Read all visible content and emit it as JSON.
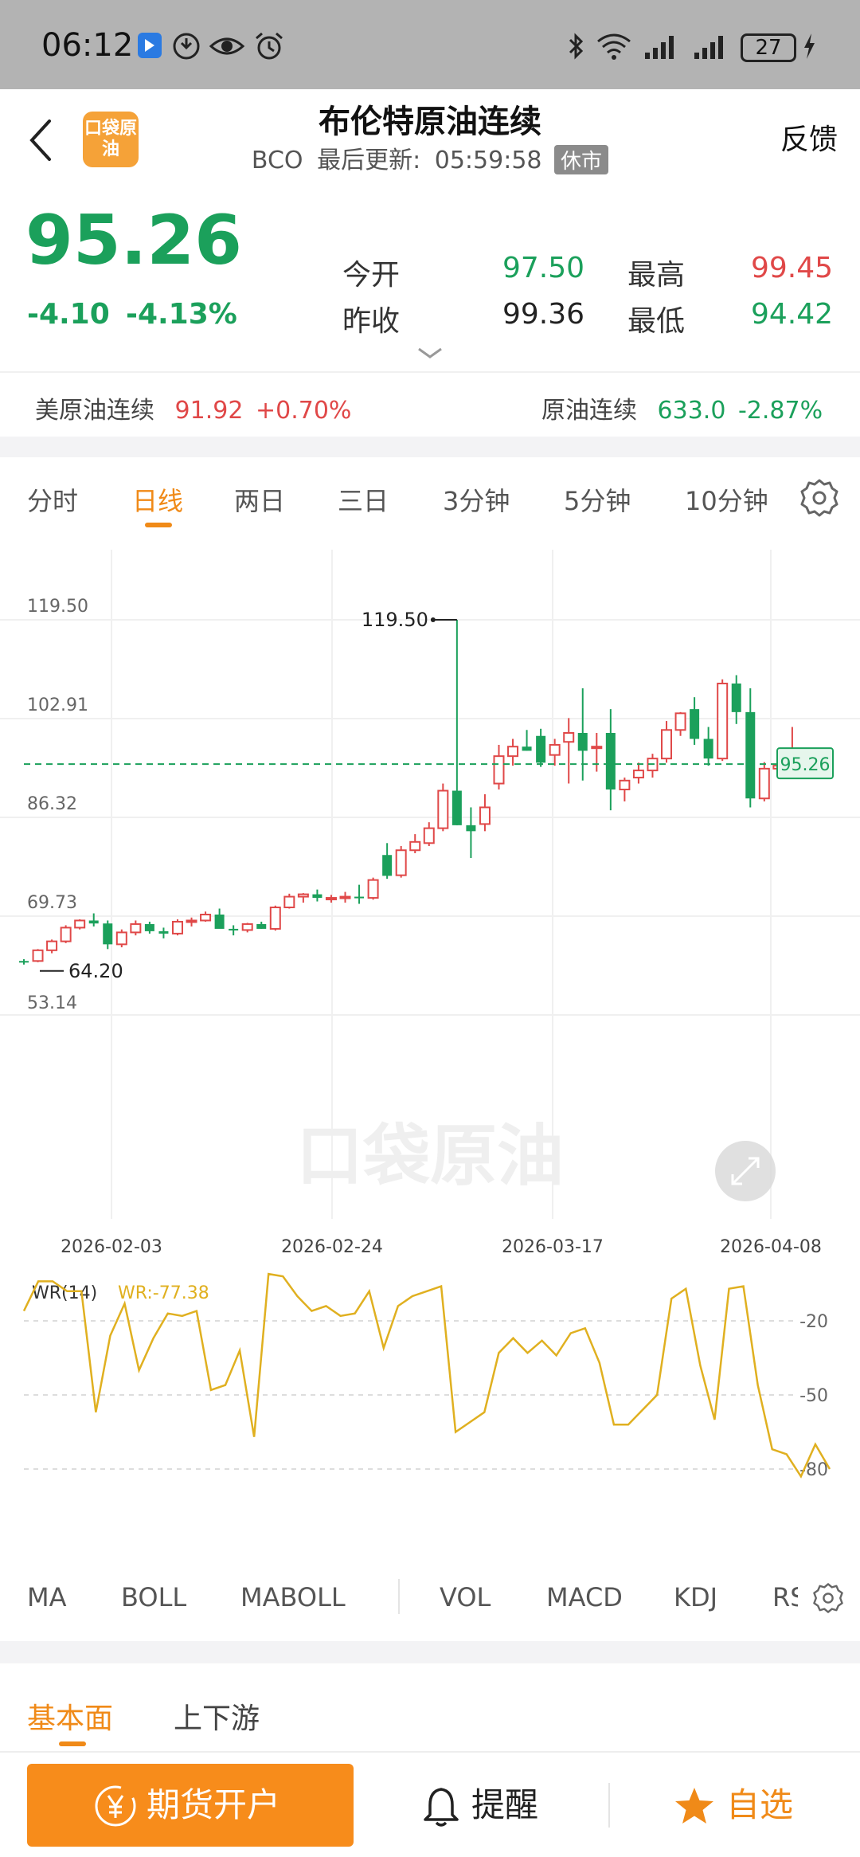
{
  "status_bar": {
    "time": "06:12",
    "battery": "27",
    "icons": [
      "app-notification-icon",
      "data-saver-icon",
      "eye-icon",
      "alarm-icon",
      "bluetooth-icon",
      "wifi-icon",
      "signal-icon",
      "signal-icon",
      "charging-icon"
    ]
  },
  "header": {
    "logo_text": "口袋原油",
    "title": "布伦特原油连续",
    "code": "BCO",
    "updated_label": "最后更新:",
    "updated_time": "05:59:58",
    "market_status": "休市",
    "feedback": "反馈"
  },
  "quote": {
    "price": "95.26",
    "change": "-4.10",
    "change_pct": "-4.13%",
    "open_label": "今开",
    "open": "97.50",
    "high_label": "最高",
    "high": "99.45",
    "prev_close_label": "昨收",
    "prev_close": "99.36",
    "low_label": "最低",
    "low": "94.42",
    "colors": {
      "down": "#1ba05b",
      "up": "#e04848"
    }
  },
  "related": [
    {
      "name": "美原油连续",
      "price": "91.92",
      "change": "+0.70%",
      "color": "#e04848"
    },
    {
      "name": "原油连续",
      "price": "633.0",
      "change": "-2.87%",
      "color": "#1ba05b"
    }
  ],
  "period_tabs": [
    "分时",
    "日线",
    "两日",
    "三日",
    "3分钟",
    "5分钟",
    "10分钟"
  ],
  "active_period": "日线",
  "chart_data": [
    {
      "type": "candlestick",
      "title": "",
      "y_ticks": [
        "119.50",
        "102.91",
        "86.32",
        "69.73",
        "53.14"
      ],
      "ylim": [
        53.14,
        119.5
      ],
      "x_ticks": [
        "2026-02-03",
        "2026-02-24",
        "2026-03-17",
        "2026-04-08"
      ],
      "annotations": {
        "max": "119.50",
        "min": "64.20",
        "current": "95.26"
      },
      "watermark": "口袋原油",
      "candles": [
        [
          62.2,
          62.5,
          61.6,
          62.0
        ],
        [
          62.2,
          64.2,
          62.0,
          64.0
        ],
        [
          64.0,
          65.8,
          63.5,
          65.5
        ],
        [
          65.5,
          68.2,
          65.2,
          67.8
        ],
        [
          67.8,
          69.2,
          67.5,
          69.0
        ],
        [
          69.0,
          70.2,
          68.0,
          68.5
        ],
        [
          68.5,
          69.0,
          64.2,
          65.0
        ],
        [
          65.0,
          67.5,
          64.5,
          67.0
        ],
        [
          67.0,
          69.0,
          66.5,
          68.4
        ],
        [
          68.4,
          68.8,
          66.8,
          67.2
        ],
        [
          67.2,
          67.8,
          66.0,
          66.8
        ],
        [
          66.8,
          69.2,
          66.5,
          68.8
        ],
        [
          68.8,
          69.5,
          68.0,
          69.0
        ],
        [
          69.0,
          70.5,
          68.8,
          70.0
        ],
        [
          70.0,
          71.0,
          69.5,
          67.6
        ],
        [
          67.6,
          68.2,
          66.5,
          67.4
        ],
        [
          67.4,
          68.6,
          67.0,
          68.4
        ],
        [
          68.4,
          68.8,
          67.6,
          67.6
        ],
        [
          67.6,
          71.5,
          67.3,
          71.2
        ],
        [
          71.2,
          73.5,
          71.0,
          73.0
        ],
        [
          73.0,
          73.6,
          72.0,
          73.4
        ],
        [
          73.4,
          74.2,
          72.2,
          72.8
        ],
        [
          72.6,
          73.3,
          72.0,
          72.8
        ],
        [
          72.8,
          73.8,
          72.0,
          73.0
        ],
        [
          73.0,
          75.0,
          71.8,
          72.8
        ],
        [
          72.8,
          76.2,
          72.5,
          75.8
        ],
        [
          80.0,
          82.0,
          76.0,
          76.5
        ],
        [
          76.6,
          81.5,
          76.2,
          80.8
        ],
        [
          80.8,
          83.5,
          80.3,
          82.2
        ],
        [
          82.0,
          85.5,
          81.5,
          84.5
        ],
        [
          84.5,
          92.0,
          84.0,
          90.8
        ],
        [
          90.8,
          119.5,
          85.0,
          85.0
        ],
        [
          85.0,
          88.0,
          79.5,
          84.0
        ],
        [
          85.2,
          90.2,
          84.0,
          88.0
        ],
        [
          92.0,
          98.5,
          91.0,
          96.6
        ],
        [
          96.6,
          99.5,
          95.0,
          98.2
        ],
        [
          98.2,
          101.0,
          97.5,
          97.5
        ],
        [
          100.0,
          101.2,
          94.8,
          95.5
        ],
        [
          96.8,
          99.5,
          95.0,
          98.5
        ],
        [
          99.0,
          103.0,
          92.0,
          100.5
        ],
        [
          100.5,
          108.0,
          92.5,
          97.5
        ],
        [
          98.2,
          100.5,
          94.0,
          98.2
        ],
        [
          100.5,
          104.5,
          87.5,
          91.0
        ],
        [
          91.0,
          93.0,
          89.0,
          92.5
        ],
        [
          93.0,
          95.5,
          92.0,
          94.2
        ],
        [
          94.2,
          97.0,
          93.0,
          96.2
        ],
        [
          96.2,
          102.5,
          95.5,
          101.0
        ],
        [
          101.0,
          104.0,
          100.0,
          103.8
        ],
        [
          104.5,
          106.5,
          98.5,
          99.5
        ],
        [
          99.5,
          101.5,
          95.0,
          96.2
        ],
        [
          96.2,
          109.5,
          95.8,
          108.8
        ],
        [
          108.8,
          110.2,
          102.0,
          104.0
        ],
        [
          104.0,
          108.0,
          88.0,
          89.5
        ],
        [
          89.5,
          95.6,
          89.0,
          94.5
        ],
        [
          94.5,
          96.0,
          93.5,
          95.0
        ],
        [
          94.2,
          101.5,
          93.8,
          95.5
        ],
        [
          95.5,
          98.0,
          95.0,
          95.5
        ],
        [
          95.5,
          96.0,
          94.2,
          95.26
        ]
      ]
    },
    {
      "type": "line",
      "title": "WR(14)",
      "series": [
        {
          "name": "WR:-77.38",
          "values": [
            -16,
            -4,
            -4,
            -8,
            -8,
            -57,
            -26,
            -13,
            -40,
            -27,
            -17,
            -18,
            -16,
            -48,
            -46,
            -32,
            -67,
            -1,
            -2,
            -10,
            -16,
            -14,
            -18,
            -17,
            -8,
            -31,
            -14,
            -10,
            -8,
            -6,
            -65,
            -61,
            -57,
            -33,
            -27,
            -33,
            -28,
            -34,
            -25,
            -23,
            -37,
            -62,
            -62,
            -56,
            -50,
            -11,
            -7,
            -38,
            -60,
            -7,
            -6,
            -46,
            -72,
            -74,
            -83,
            -70,
            -80
          ]
        }
      ],
      "y_ticks": [
        "-20",
        "-50",
        "-80"
      ],
      "ylim": [
        -100,
        0
      ]
    }
  ],
  "indicator_tabs": [
    "MA",
    "BOLL",
    "MABOLL",
    "VOL",
    "MACD",
    "KDJ",
    "RS"
  ],
  "bottom_tabs": [
    "基本面",
    "上下游"
  ],
  "actions": {
    "open_account": "期货开户",
    "remind": "提醒",
    "watchlist": "自选"
  }
}
